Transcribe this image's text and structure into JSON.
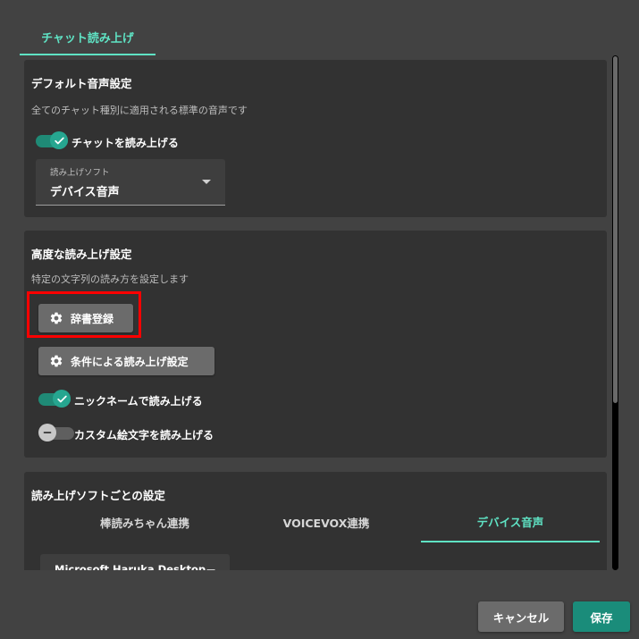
{
  "tabs": [
    {
      "label": "チャット読み上げ",
      "active": true
    }
  ],
  "default_section": {
    "title": "デフォルト音声設定",
    "description": "全てのチャット種別に適用される標準の音声です",
    "read_chat_toggle": {
      "label": "チャットを読み上げる",
      "on": true
    },
    "software_select": {
      "label": "読み上げソフト",
      "value": "デバイス音声"
    }
  },
  "advanced_section": {
    "title": "高度な読み上げ設定",
    "description": "特定の文字列の読み方を設定します",
    "dictionary_button": "辞書登録",
    "conditional_button": "条件による読み上げ設定",
    "nickname_toggle": {
      "label": "ニックネームで読み上げる",
      "on": true
    },
    "custom_emoji_toggle": {
      "label": "カスタム絵文字を読み上げる",
      "on": false
    }
  },
  "per_software_section": {
    "title": "読み上げソフトごとの設定",
    "tabs": [
      {
        "label": "棒読みちゃん連携",
        "active": false
      },
      {
        "label": "VOICEVOX連携",
        "active": false
      },
      {
        "label": "デバイス音声",
        "active": true
      }
    ],
    "voice_select_value": "Microsoft Haruka Desktop"
  },
  "footer": {
    "cancel_label": "キャンセル",
    "save_label": "保存"
  },
  "colors": {
    "accent": "#5fe3c4",
    "toggle_on": "#26a690",
    "save": "#1a8c7a",
    "highlight": "#ff0000"
  },
  "icons": {
    "gear": "gear-icon",
    "check": "check-icon",
    "minus": "minus-icon",
    "caret": "caret-down-icon"
  }
}
